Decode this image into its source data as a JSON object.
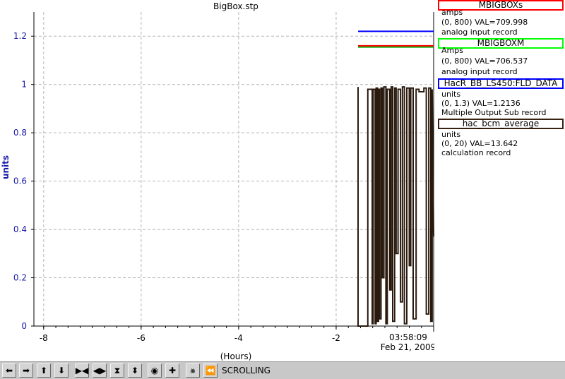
{
  "chart_data": {
    "type": "line",
    "title": "BigBox.stp",
    "xlabel": "(Hours)",
    "ylabel": "units",
    "xlim": [
      -8.2,
      0
    ],
    "ylim": [
      0,
      1.3
    ],
    "x_ticks": [
      -8,
      -6,
      -4,
      -2
    ],
    "x_tick_labels": [
      "-8",
      "-6",
      "-4",
      "-2"
    ],
    "y_ticks": [
      0,
      0.2,
      0.4,
      0.6,
      0.8,
      1,
      1.2
    ],
    "y_tick_labels": [
      "0",
      "0.2",
      "0.4",
      "0.6",
      "0.8",
      "1",
      "1.2"
    ],
    "time_label": "03:58:09",
    "date_label": "Feb 21, 2009",
    "grid": true,
    "series": [
      {
        "name": "MBIGBOXs",
        "color": "#0000ff",
        "x": [
          -1.55,
          0
        ],
        "y": [
          1.22,
          1.22
        ]
      },
      {
        "name": "MBIGBOXM",
        "color": "#00aa00",
        "x": [
          -1.55,
          0
        ],
        "y": [
          1.155,
          1.155
        ]
      },
      {
        "name": "HacR_BB_LS450:FLD_DATA",
        "color": "#ff0000",
        "x": [
          -1.55,
          0
        ],
        "y": [
          1.16,
          1.16
        ]
      },
      {
        "name": "hac_bcm_average",
        "color": "#2a1a0e",
        "x": [
          -1.55,
          -1.55,
          -1.35,
          -1.35,
          -1.26,
          -1.26,
          -1.24,
          -1.24,
          -1.2,
          -1.2,
          -1.18,
          -1.18,
          -1.15,
          -1.15,
          -1.13,
          -1.13,
          -1.11,
          -1.11,
          -1.08,
          -1.08,
          -1.05,
          -1.05,
          -1.02,
          -1.02,
          -0.98,
          -0.98,
          -0.95,
          -0.95,
          -0.9,
          -0.9,
          -0.87,
          -0.87,
          -0.84,
          -0.84,
          -0.8,
          -0.8,
          -0.77,
          -0.77,
          -0.73,
          -0.73,
          -0.68,
          -0.68,
          -0.64,
          -0.64,
          -0.6,
          -0.6,
          -0.55,
          -0.55,
          -0.5,
          -0.5,
          -0.47,
          -0.47,
          -0.42,
          -0.42,
          -0.36,
          -0.36,
          -0.3,
          -0.3,
          -0.2,
          -0.2,
          -0.15,
          -0.15,
          -0.1,
          -0.1,
          -0.06,
          -0.06,
          -0.03,
          -0.03,
          0
        ],
        "y": [
          0.99,
          0,
          0,
          0.98,
          0.98,
          0.01,
          0.01,
          0.98,
          0.98,
          0.01,
          0.01,
          0.985,
          0.985,
          0.02,
          0.02,
          0.98,
          0.98,
          0.03,
          0.03,
          0.985,
          0.985,
          0.2,
          0.2,
          0.99,
          0.99,
          0.01,
          0.01,
          0.98,
          0.98,
          0.15,
          0.15,
          0.99,
          0.99,
          0.02,
          0.02,
          0.985,
          0.985,
          0.3,
          0.3,
          0.98,
          0.98,
          0.1,
          0.1,
          0.99,
          0.99,
          0.01,
          0.01,
          0.985,
          0.985,
          0.25,
          0.25,
          0.985,
          0.985,
          0.03,
          0.03,
          0.98,
          0.98,
          0.97,
          0.97,
          0.985,
          0.985,
          0.05,
          0.05,
          0.985,
          0.985,
          0.02,
          0.02,
          0.98,
          0.37
        ]
      }
    ]
  },
  "legend": [
    {
      "name": "MBIGBOXs",
      "color": "#ff0000",
      "units": "amps",
      "range": "(0, 800) VAL=709.998",
      "rtype": "analog input record"
    },
    {
      "name": "MBIGBOXM",
      "color": "#00ff00",
      "units": "Amps",
      "range": "(0, 800) VAL=706.537",
      "rtype": "analog input record"
    },
    {
      "name": "HacR_BB_LS450:FLD_DATA",
      "color": "#0000ff",
      "units": "units",
      "range": "(0, 1.3) VAL=1.2136",
      "rtype": "Multiple Output Sub record"
    },
    {
      "name": "hac_bcm_average",
      "color": "#3a2010",
      "units": "units",
      "range": "(0, 20) VAL=13.642",
      "rtype": "calculation record"
    }
  ],
  "toolbar": {
    "buttons": [
      "arrow-left-icon",
      "arrow-right-icon",
      "arrow-up-icon",
      "arrow-down-icon",
      "zoom-in-horizontal-icon",
      "zoom-out-horizontal-icon",
      "zoom-in-vertical-icon",
      "zoom-out-vertical-icon",
      "circle-icon",
      "plus-icon",
      "autoscale-icon",
      "scroll-back-icon"
    ],
    "status": "SCROLLING"
  }
}
